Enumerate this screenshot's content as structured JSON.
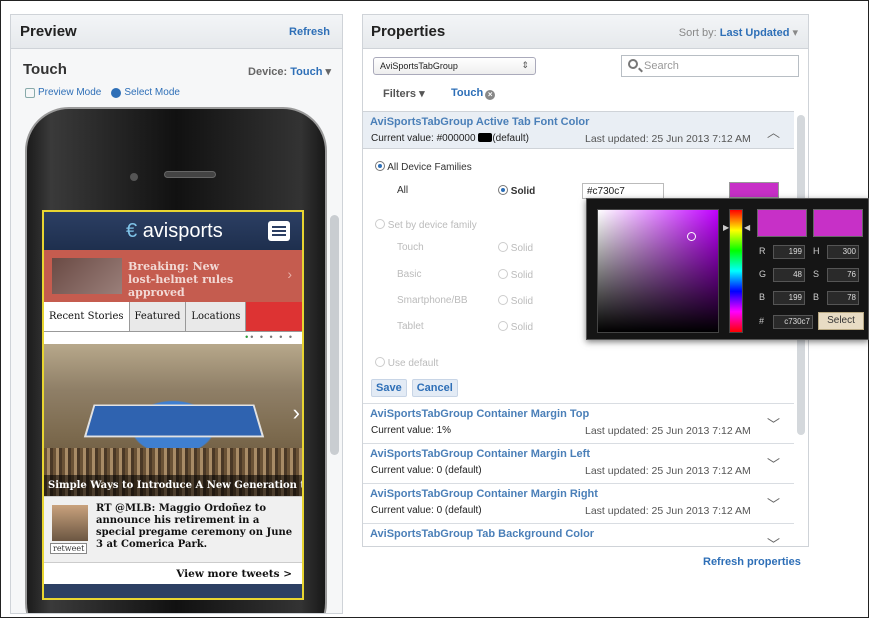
{
  "preview": {
    "title": "Preview",
    "refresh": "Refresh",
    "device_title": "Touch",
    "device_label": "Device:",
    "device_value": "Touch",
    "preview_mode": "Preview Mode",
    "select_mode": "Select Mode"
  },
  "phone_app": {
    "logo": "avisports",
    "banner_text": "Breaking: New lost-helmet rules approved",
    "tabs": [
      "Recent Stories",
      "Featured",
      "Locations"
    ],
    "dots": "• • • • •",
    "photo_caption": "Simple Ways to Introduce A New Generation t...",
    "tweet_text": "RT @MLB: Maggio Ordoñez to announce his retirement in a special pregame ceremony on June 3 at Comerica Park.",
    "retweet": "retweet",
    "more": "View more tweets >"
  },
  "properties": {
    "title": "Properties",
    "sort_label": "Sort by:",
    "sort_value": "Last Updated",
    "component_select": "AviSportsTabGroup",
    "search_placeholder": "Search",
    "filters_label": "Filters",
    "filter_chip": "Touch",
    "refresh": "Refresh properties"
  },
  "open_property": {
    "name": "AviSportsTabGroup Active Tab Font Color",
    "current": "Current value: #000000",
    "current_suffix": "(default)",
    "updated": "Last updated: 25 Jun 2013 7:12 AM",
    "all_families": "All Device Families",
    "all_label": "All",
    "solid": "Solid",
    "hex_value": "#c730c7",
    "set_by_family": "Set by device family",
    "families": [
      "Touch",
      "Basic",
      "Smartphone/BB",
      "Tablet"
    ],
    "use_default": "Use default",
    "save": "Save",
    "cancel": "Cancel"
  },
  "collapsed_properties": [
    {
      "name": "AviSportsTabGroup Container Margin Top",
      "current": "Current value: 1%",
      "updated": "Last updated: 25 Jun 2013 7:12 AM"
    },
    {
      "name": "AviSportsTabGroup Container Margin Left",
      "current": "Current value: 0 (default)",
      "updated": "Last updated: 25 Jun 2013 7:12 AM"
    },
    {
      "name": "AviSportsTabGroup Container Margin Right",
      "current": "Current value: 0 (default)",
      "updated": "Last updated: 25 Jun 2013 7:12 AM"
    },
    {
      "name": "AviSportsTabGroup Tab Background Color",
      "current": "",
      "updated": ""
    }
  ],
  "color_picker": {
    "r": "199",
    "g": "48",
    "b": "199",
    "h": "300",
    "s": "76",
    "bb": "78",
    "hex": "c730c7",
    "select": "Select",
    "labels": {
      "r": "R",
      "g": "G",
      "b": "B",
      "h": "H",
      "s": "S",
      "b2": "B",
      "hash": "#"
    }
  },
  "colors": {
    "accent": "#2e6fb7",
    "picked": "#c730c7",
    "highlight": "#e8d531"
  }
}
